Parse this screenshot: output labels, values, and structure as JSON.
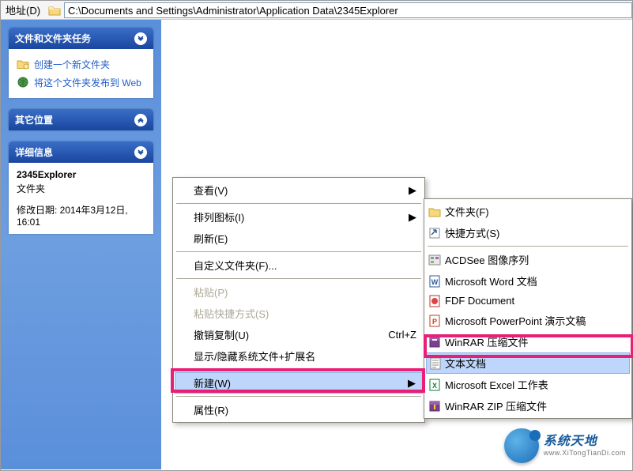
{
  "address": {
    "label": "地址(D)",
    "path": "C:\\Documents and Settings\\Administrator\\Application Data\\2345Explorer"
  },
  "sidebar": {
    "tasks": {
      "title": "文件和文件夹任务",
      "items": [
        {
          "label": "创建一个新文件夹"
        },
        {
          "label": "将这个文件夹发布到 Web"
        }
      ]
    },
    "other": {
      "title": "其它位置"
    },
    "details": {
      "title": "详细信息",
      "name": "2345Explorer",
      "type": "文件夹",
      "modified": "修改日期: 2014年3月12日, 16:01"
    }
  },
  "ctx1": [
    {
      "label": "查看(V)",
      "arrow": true
    },
    {
      "sep": true
    },
    {
      "label": "排列图标(I)",
      "arrow": true
    },
    {
      "label": "刷新(E)"
    },
    {
      "sep": true
    },
    {
      "label": "自定义文件夹(F)..."
    },
    {
      "sep": true
    },
    {
      "label": "粘贴(P)",
      "disabled": true
    },
    {
      "label": "粘贴快捷方式(S)",
      "disabled": true
    },
    {
      "label": "撤销复制(U)",
      "shortcut": "Ctrl+Z"
    },
    {
      "label": "显示/隐藏系统文件+扩展名"
    },
    {
      "sep": true
    },
    {
      "label": "新建(W)",
      "arrow": true,
      "selected": true
    },
    {
      "sep": true
    },
    {
      "label": "属性(R)"
    }
  ],
  "ctx2": [
    {
      "label": "文件夹(F)",
      "icon": "folder"
    },
    {
      "label": "快捷方式(S)",
      "icon": "shortcut"
    },
    {
      "sep": true
    },
    {
      "label": "ACDSee 图像序列",
      "icon": "acdsee"
    },
    {
      "label": "Microsoft Word 文档",
      "icon": "word"
    },
    {
      "label": "FDF Document",
      "icon": "fdf"
    },
    {
      "label": "Microsoft PowerPoint 演示文稿",
      "icon": "ppt"
    },
    {
      "label": "WinRAR 压缩文件",
      "icon": "rar"
    },
    {
      "label": "文本文档",
      "icon": "txt",
      "selected": true
    },
    {
      "label": "Microsoft Excel 工作表",
      "icon": "excel"
    },
    {
      "label": "WinRAR ZIP 压缩文件",
      "icon": "zip"
    }
  ],
  "watermark": {
    "line1": "系统天地",
    "line2": "www.XiTongTianDi.com"
  }
}
